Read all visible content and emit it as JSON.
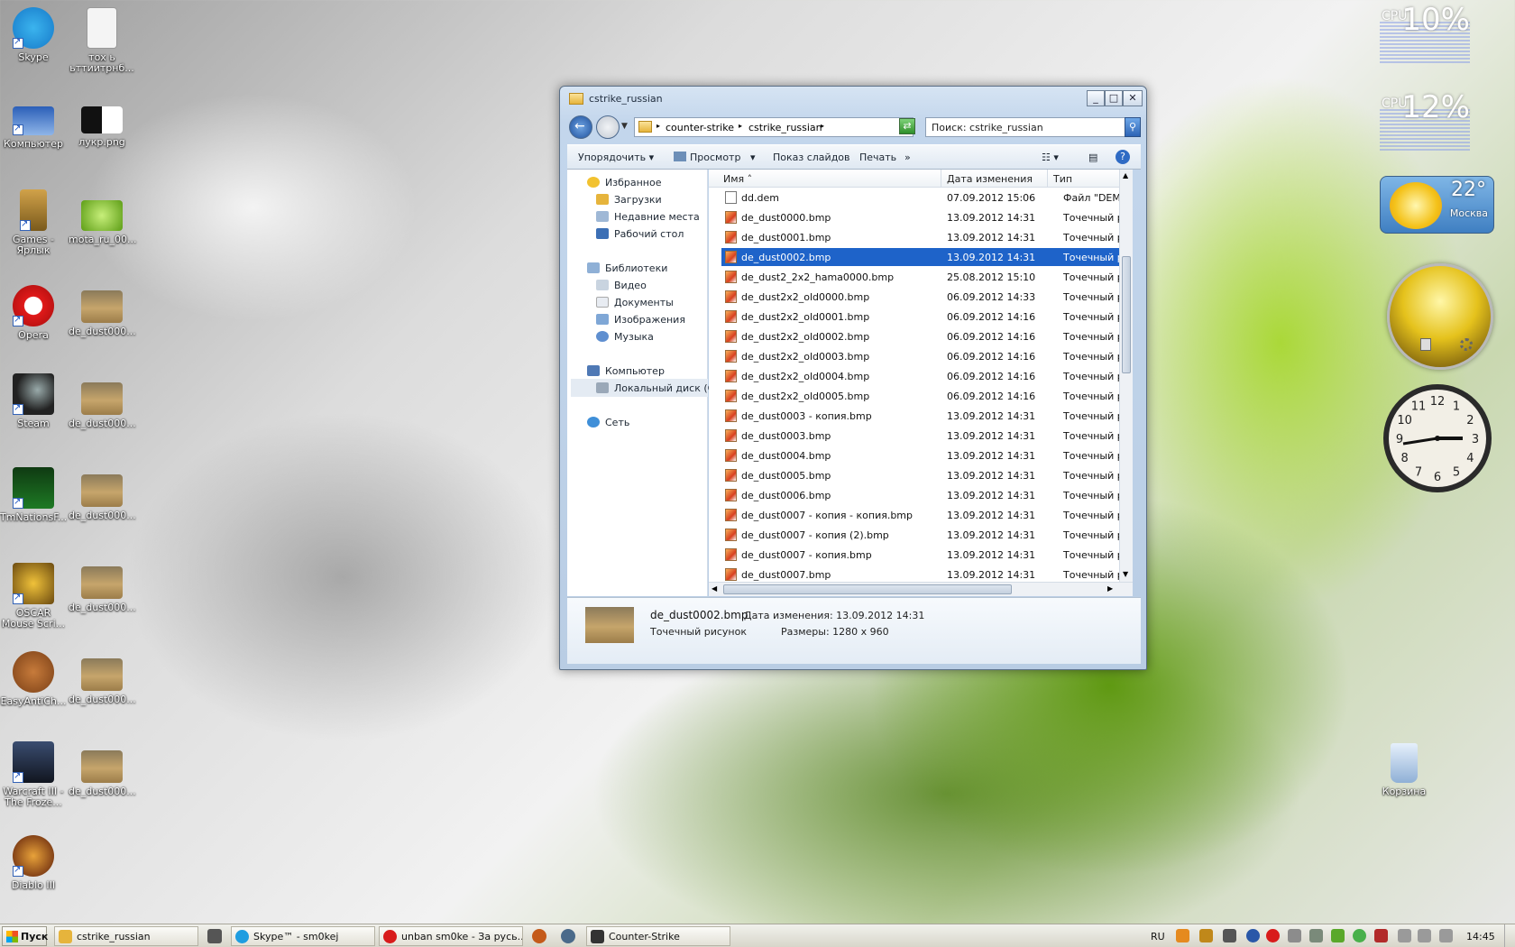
{
  "desktop_icons": [
    {
      "label": "Skype"
    },
    {
      "label": "тох ь ьттиитрнб..."
    },
    {
      "label": "Компьютер"
    },
    {
      "label": "лукр.png"
    },
    {
      "label": "Games - Ярлык"
    },
    {
      "label": "mota_ru_00..."
    },
    {
      "label": "Opera"
    },
    {
      "label": "de_dust000..."
    },
    {
      "label": "Steam"
    },
    {
      "label": "de_dust000..."
    },
    {
      "label": "TmNationsF..."
    },
    {
      "label": "de_dust000..."
    },
    {
      "label": "OSCAR Mouse Scri..."
    },
    {
      "label": "de_dust000..."
    },
    {
      "label": "EasyAntiCh..."
    },
    {
      "label": "de_dust000..."
    },
    {
      "label": "Warcraft III - The Froze..."
    },
    {
      "label": "de_dust000..."
    },
    {
      "label": "Diablo III"
    },
    {
      "label": "Корзина"
    }
  ],
  "window": {
    "title": "cstrike_russian",
    "breadcrumb": [
      "counter-strike",
      "cstrike_russian"
    ],
    "search_placeholder": "Поиск: cstrike_russian",
    "toolbar": {
      "organize": "Упорядочить",
      "view": "Просмотр",
      "slideshow": "Показ слайдов",
      "print": "Печать",
      "more": "»"
    },
    "nav": {
      "favorites": "Избранное",
      "downloads": "Загрузки",
      "recent": "Недавние места",
      "desktop": "Рабочий стол",
      "libraries": "Библиотеки",
      "video": "Видео",
      "documents": "Документы",
      "images": "Изображения",
      "music": "Музыка",
      "computer": "Компьютер",
      "local_disk": "Локальный диск (C:)",
      "network": "Сеть"
    },
    "columns": {
      "name": "Имя",
      "date": "Дата изменения",
      "type": "Тип"
    },
    "files": [
      {
        "name": "dd.dem",
        "date": "07.09.2012 15:06",
        "type": "Файл \"DEM\""
      },
      {
        "name": "de_dust0000.bmp",
        "date": "13.09.2012 14:31",
        "type": "Точечный р"
      },
      {
        "name": "de_dust0001.bmp",
        "date": "13.09.2012 14:31",
        "type": "Точечный р"
      },
      {
        "name": "de_dust0002.bmp",
        "date": "13.09.2012 14:31",
        "type": "Точечный р"
      },
      {
        "name": "de_dust2_2x2_hama0000.bmp",
        "date": "25.08.2012 15:10",
        "type": "Точечный р"
      },
      {
        "name": "de_dust2x2_old0000.bmp",
        "date": "06.09.2012 14:33",
        "type": "Точечный р"
      },
      {
        "name": "de_dust2x2_old0001.bmp",
        "date": "06.09.2012 14:16",
        "type": "Точечный р"
      },
      {
        "name": "de_dust2x2_old0002.bmp",
        "date": "06.09.2012 14:16",
        "type": "Точечный р"
      },
      {
        "name": "de_dust2x2_old0003.bmp",
        "date": "06.09.2012 14:16",
        "type": "Точечный р"
      },
      {
        "name": "de_dust2x2_old0004.bmp",
        "date": "06.09.2012 14:16",
        "type": "Точечный р"
      },
      {
        "name": "de_dust2x2_old0005.bmp",
        "date": "06.09.2012 14:16",
        "type": "Точечный р"
      },
      {
        "name": "de_dust0003 - копия.bmp",
        "date": "13.09.2012 14:31",
        "type": "Точечный р"
      },
      {
        "name": "de_dust0003.bmp",
        "date": "13.09.2012 14:31",
        "type": "Точечный р"
      },
      {
        "name": "de_dust0004.bmp",
        "date": "13.09.2012 14:31",
        "type": "Точечный р"
      },
      {
        "name": "de_dust0005.bmp",
        "date": "13.09.2012 14:31",
        "type": "Точечный р"
      },
      {
        "name": "de_dust0006.bmp",
        "date": "13.09.2012 14:31",
        "type": "Точечный р"
      },
      {
        "name": "de_dust0007 - копия - копия.bmp",
        "date": "13.09.2012 14:31",
        "type": "Точечный р"
      },
      {
        "name": "de_dust0007 - копия (2).bmp",
        "date": "13.09.2012 14:31",
        "type": "Точечный р"
      },
      {
        "name": "de_dust0007 - копия.bmp",
        "date": "13.09.2012 14:31",
        "type": "Точечный р"
      },
      {
        "name": "de_dust0007.bmp",
        "date": "13.09.2012 14:31",
        "type": "Точечный р"
      }
    ],
    "selected_index": 3,
    "details": {
      "name": "de_dust0002.bmp",
      "date_label": "Дата изменения: 13.09.2012 14:31",
      "type": "Точечный рисунок",
      "size_label": "Размеры: 1280 x 960"
    }
  },
  "gadgets": {
    "cpu1": {
      "label": "CPU",
      "value": "10%"
    },
    "cpu2": {
      "label": "CPU",
      "value": "12%"
    },
    "weather": {
      "temp": "22°",
      "city": "Москва"
    },
    "clock_numbers": [
      "12",
      "1",
      "2",
      "3",
      "4",
      "5",
      "6",
      "7",
      "8",
      "9",
      "10",
      "11"
    ]
  },
  "taskbar": {
    "start": "Пуск",
    "tasks": [
      {
        "label": "cstrike_russian"
      },
      {
        "label": "Skype™ - sm0kej"
      },
      {
        "label": "unban sm0ke - За русь..."
      },
      {
        "label": "Counter-Strike"
      }
    ],
    "lang": "RU",
    "time": "14:45"
  }
}
